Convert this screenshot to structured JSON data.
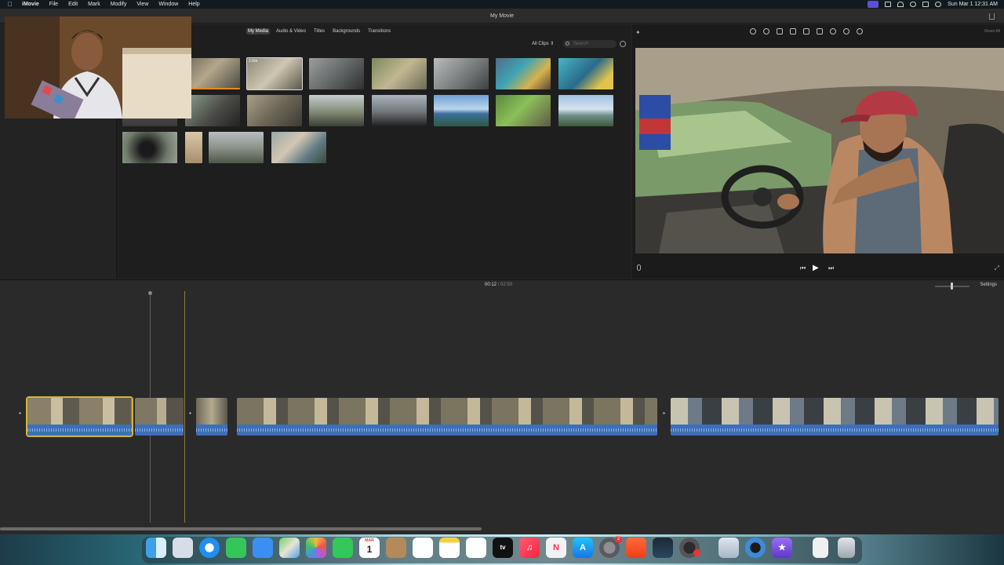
{
  "menubar": {
    "app_name": "iMovie",
    "menus": [
      "File",
      "Edit",
      "Mark",
      "Modify",
      "View",
      "Window",
      "Help"
    ],
    "clock": "Sun Mar 1  12:31 AM"
  },
  "window": {
    "title": "My Movie"
  },
  "browser": {
    "tabs": [
      "My Media",
      "Audio & Video",
      "Titles",
      "Backgrounds",
      "Transitions"
    ],
    "active_tab": "My Media",
    "filter_label": "All Clips",
    "search_placeholder": "Search",
    "thumb_badge": "2.6m"
  },
  "viewer": {
    "reset_label": "Reset All"
  },
  "timeline": {
    "current_time": "00:12",
    "separator": "/",
    "duration": "02:50",
    "settings_label": "Settings"
  },
  "dock": {
    "calendar_month": "MAR",
    "calendar_day": "1",
    "settings_badge": "2",
    "icons": [
      "finder-icon",
      "launchpad-icon",
      "safari-icon",
      "messages-icon",
      "mail-icon",
      "maps-icon",
      "photos-icon",
      "facetime-icon",
      "calendar-icon",
      "contacts-icon",
      "reminders-icon",
      "notes-icon",
      "freeform-icon",
      "apple-tv-icon",
      "music-icon",
      "news-icon",
      "app-store-icon",
      "system-settings-icon",
      "brave-icon",
      "steam-icon",
      "obs-icon",
      "preview-icon",
      "quicktime-icon",
      "imovie-icon",
      "document-icon",
      "trash-icon"
    ]
  },
  "colors": {
    "accent_orange": "#e38b23",
    "selection_yellow": "#d4b33c",
    "audio_blue": "#3e6fb8"
  }
}
